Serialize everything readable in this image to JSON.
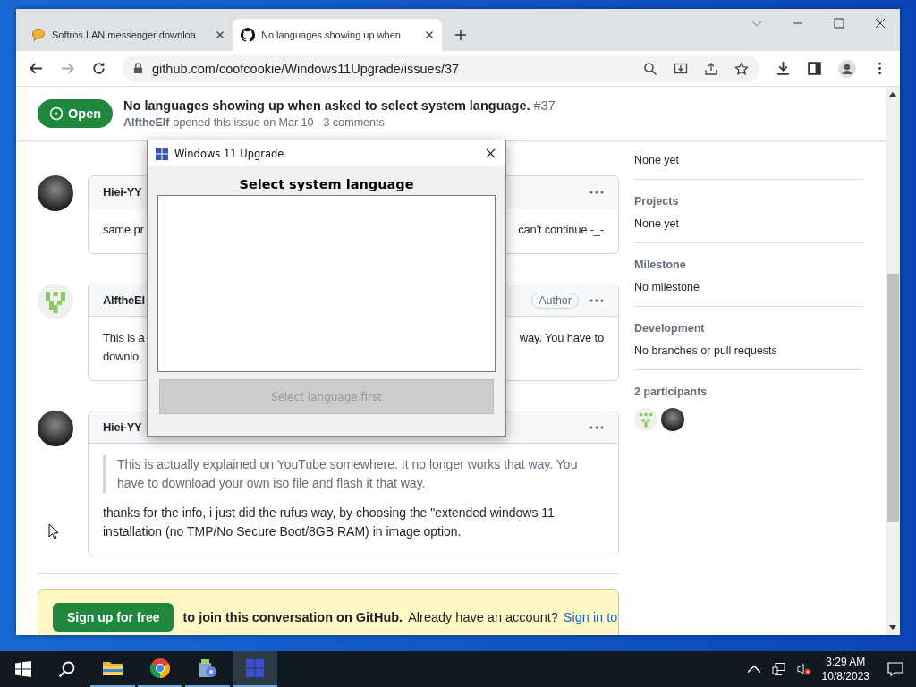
{
  "browser": {
    "tabs": [
      {
        "title": "Softros LAN messenger downloa",
        "kind": "chat",
        "selected": false
      },
      {
        "title": "No languages showing up when",
        "kind": "github",
        "selected": true
      }
    ],
    "url": "github.com/coofcookie/Windows11Upgrade/issues/37"
  },
  "issue": {
    "state": "Open",
    "title": "No languages showing up when asked to select system language.",
    "number": "#37",
    "author": "AlftheElf",
    "meta": "opened this issue on Mar 10 · 3 comments"
  },
  "comments": [
    {
      "author": "Hiei-YY",
      "avatar": {
        "kind": "photo"
      },
      "kind": "fragments",
      "lines": [
        {
          "left": "same pr",
          "right": "can't continue -_-"
        }
      ]
    },
    {
      "author": "AlftheEl",
      "avatar": {
        "kind": "identicon"
      },
      "badge": "Author",
      "kind": "fragments",
      "lines": [
        {
          "left": "This is a",
          "right": "way. You have to"
        },
        {
          "left": "downlo"
        }
      ]
    },
    {
      "author": "Hiei-YY",
      "avatar": {
        "kind": "photo"
      },
      "kind": "full",
      "quote": "This is actually explained on YouTube somewhere. It no longer works that way. You have to download your own iso file and flash it that way.",
      "text": "thanks for the info, i just did the rufus way, by choosing the \"extended windows 11 installation (no TMP/No Secure Boot/8GB RAM) in image option."
    }
  ],
  "sidebar": [
    {
      "value": "None yet"
    },
    {
      "heading": "Projects",
      "value": "None yet"
    },
    {
      "heading": "Milestone",
      "value": "No milestone"
    },
    {
      "heading": "Development",
      "value": "No branches or pull requests"
    }
  ],
  "participants": {
    "label": "2 participants",
    "avatars": [
      {
        "kind": "identicon"
      },
      {
        "kind": "photo"
      }
    ]
  },
  "banner": {
    "button": "Sign up for free",
    "text": "to join this conversation on GitHub.",
    "prompt": "Already have an account?",
    "link": "Sign in to"
  },
  "dialog": {
    "title": "Windows 11 Upgrade",
    "heading": "Select system language",
    "button": "Select language first",
    "button_disabled": true
  },
  "taskbar": {
    "apps": [
      {
        "kind": "files",
        "active": false
      },
      {
        "kind": "browser",
        "active": false
      },
      {
        "kind": "installer",
        "active": false
      },
      {
        "kind": "upgrade",
        "active": true
      }
    ],
    "time": "3:29 AM",
    "date": "10/8/2023"
  }
}
